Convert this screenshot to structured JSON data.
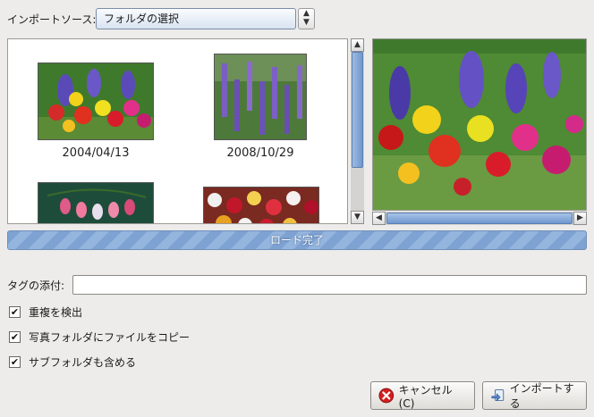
{
  "source": {
    "label": "インポートソース:",
    "selected": "フォルダの選択"
  },
  "thumbnails": [
    {
      "date": "2004/04/13"
    },
    {
      "date": "2008/10/29"
    }
  ],
  "progress": {
    "label": "ロード完了",
    "fraction": 1.0
  },
  "tags": {
    "label": "タグの添付:",
    "value": ""
  },
  "options": [
    {
      "label": "重複を検出",
      "checked": true
    },
    {
      "label": "写真フォルダにファイルをコピー",
      "checked": true
    },
    {
      "label": "サブフォルダも含める",
      "checked": true
    }
  ],
  "buttons": {
    "cancel_label": "キャンセル(C)",
    "import_label": "インポートする"
  },
  "icons": {
    "dropdown": "spin-up-down-icon",
    "cancel": "cancel-icon",
    "import": "import-icon"
  },
  "colors": {
    "accent": "#7ea2d2",
    "cancel": "#d21f1f"
  }
}
